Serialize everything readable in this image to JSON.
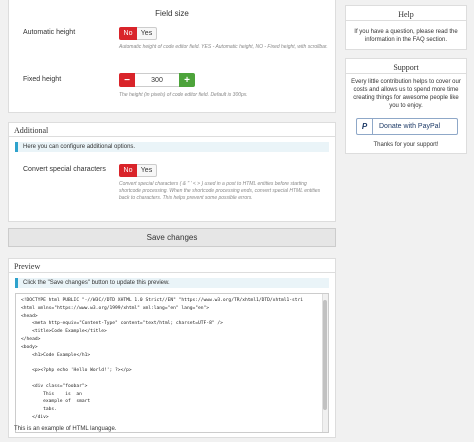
{
  "field_size": {
    "heading": "Field size",
    "automatic_height": {
      "label": "Automatic height",
      "no": "No",
      "yes": "Yes",
      "help": "Automatic height of code editor field. YES - Automatic height, NO - Fixed height, with scrollbar."
    },
    "fixed_height": {
      "label": "Fixed height",
      "minus": "−",
      "value": "300",
      "plus": "+",
      "help": "The height (in pixels) of code editor field. Default is 300px."
    }
  },
  "additional": {
    "title": "Additional",
    "notice": "Here you can configure additional options.",
    "convert": {
      "label": "Convert special characters",
      "no": "No",
      "yes": "Yes",
      "help": "Convert special characters ( & \" ' < > ) used in a post to HTML entities before starting shortcode processing. When the shortcode processing ends, convert special HTML entities back to characters. This helps prevent some possible errors."
    }
  },
  "save_button": "Save changes",
  "preview": {
    "title": "Preview",
    "notice": "Click the \"Save changes\" button to update this preview.",
    "code_lines": [
      "<!DOCTYPE html PUBLIC \"-//W3C//DTD XHTML 1.0 Strict//EN\" \"https://www.w3.org/TR/xhtml1/DTD/xhtml1-stri",
      "<html xmlns=\"https://www.w3.org/1999/xhtml\" xml:lang=\"en\" lang=\"en\">",
      "<head>",
      "    <meta http-equiv=\"Content-Type\" content=\"text/html; charset=UTF-8\" />",
      "    <title>Code Example</title>",
      "</head>",
      "<body>",
      "    <h1>Code Example</h1>",
      "",
      "    <p><?php echo 'Hello World!'; ?></p>",
      "",
      "    <div class=\"foobar\">",
      "        This    is  an",
      "        example of  smart",
      "        tabs.",
      "    </div>"
    ],
    "caption": "This is an example of HTML language."
  },
  "help_box": {
    "title": "Help",
    "text": "If you have a question, please read the information in the FAQ section."
  },
  "support_box": {
    "title": "Support",
    "text": "Every little contribution helps to cover our costs and allows us to spend more time creating things for awesome people like you to enjoy.",
    "paypal_icon": "P",
    "paypal_label": "Donate with PayPal",
    "thanks": "Thanks for your support!"
  }
}
